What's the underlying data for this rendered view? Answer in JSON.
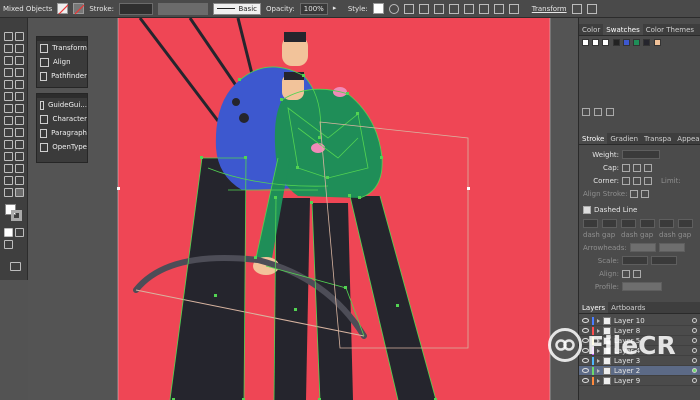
{
  "control_bar": {
    "selection": "Mixed Objects",
    "stroke_label": "Stroke:",
    "basic_label": "Basic",
    "opacity_label": "Opacity:",
    "opacity_value": "100%",
    "style_label": "Style:",
    "transform_label": "Transform"
  },
  "floating_panels": {
    "group1": [
      "Transform",
      "Align",
      "Pathfinder"
    ],
    "group2": [
      "GuideGui...",
      "Character",
      "Paragraph",
      "OpenType"
    ]
  },
  "right_panel": {
    "top_tabs": [
      "Color",
      "Swatches",
      "Color Themes"
    ],
    "stroke_tabs": [
      "Stroke",
      "Gradien",
      "Transpa",
      "Appeara"
    ],
    "weight_label": "Weight:",
    "cap_label": "Cap:",
    "corner_label": "Corner:",
    "limit_label": "Limit:",
    "align_stroke_label": "Align Stroke:",
    "dashed_line_label": "Dashed Line",
    "dash_labels": [
      "dash",
      "gap",
      "dash",
      "gap",
      "dash",
      "gap"
    ],
    "arrowheads_label": "Arrowheads:",
    "scale_label": "Scale:",
    "align_label": "Align:",
    "profile_label": "Profile:",
    "layers_tabs": [
      "Layers",
      "Artboards"
    ],
    "layers": [
      {
        "name": "Layer 10",
        "color": "#4a7dff",
        "selected": false
      },
      {
        "name": "Layer 8",
        "color": "#ff4f4f",
        "selected": false
      },
      {
        "name": "Layer 5",
        "color": "#f4e15a",
        "selected": false
      },
      {
        "name": "Layer 4",
        "color": "#c15aff",
        "selected": false
      },
      {
        "name": "Layer 3",
        "color": "#4fb6ff",
        "selected": false
      },
      {
        "name": "Layer 2",
        "color": "#6cd96c",
        "selected": true
      },
      {
        "name": "Layer 9",
        "color": "#ff8a3d",
        "selected": false
      }
    ]
  },
  "watermark": {
    "text": "FileCR"
  },
  "colors": {
    "artboard": "#ef4655",
    "selection_green": "#52d452",
    "figure_blue": "#3d58cf",
    "figure_green": "#1f8e58",
    "pants": "#25252d",
    "skin": "#f2c39a"
  }
}
